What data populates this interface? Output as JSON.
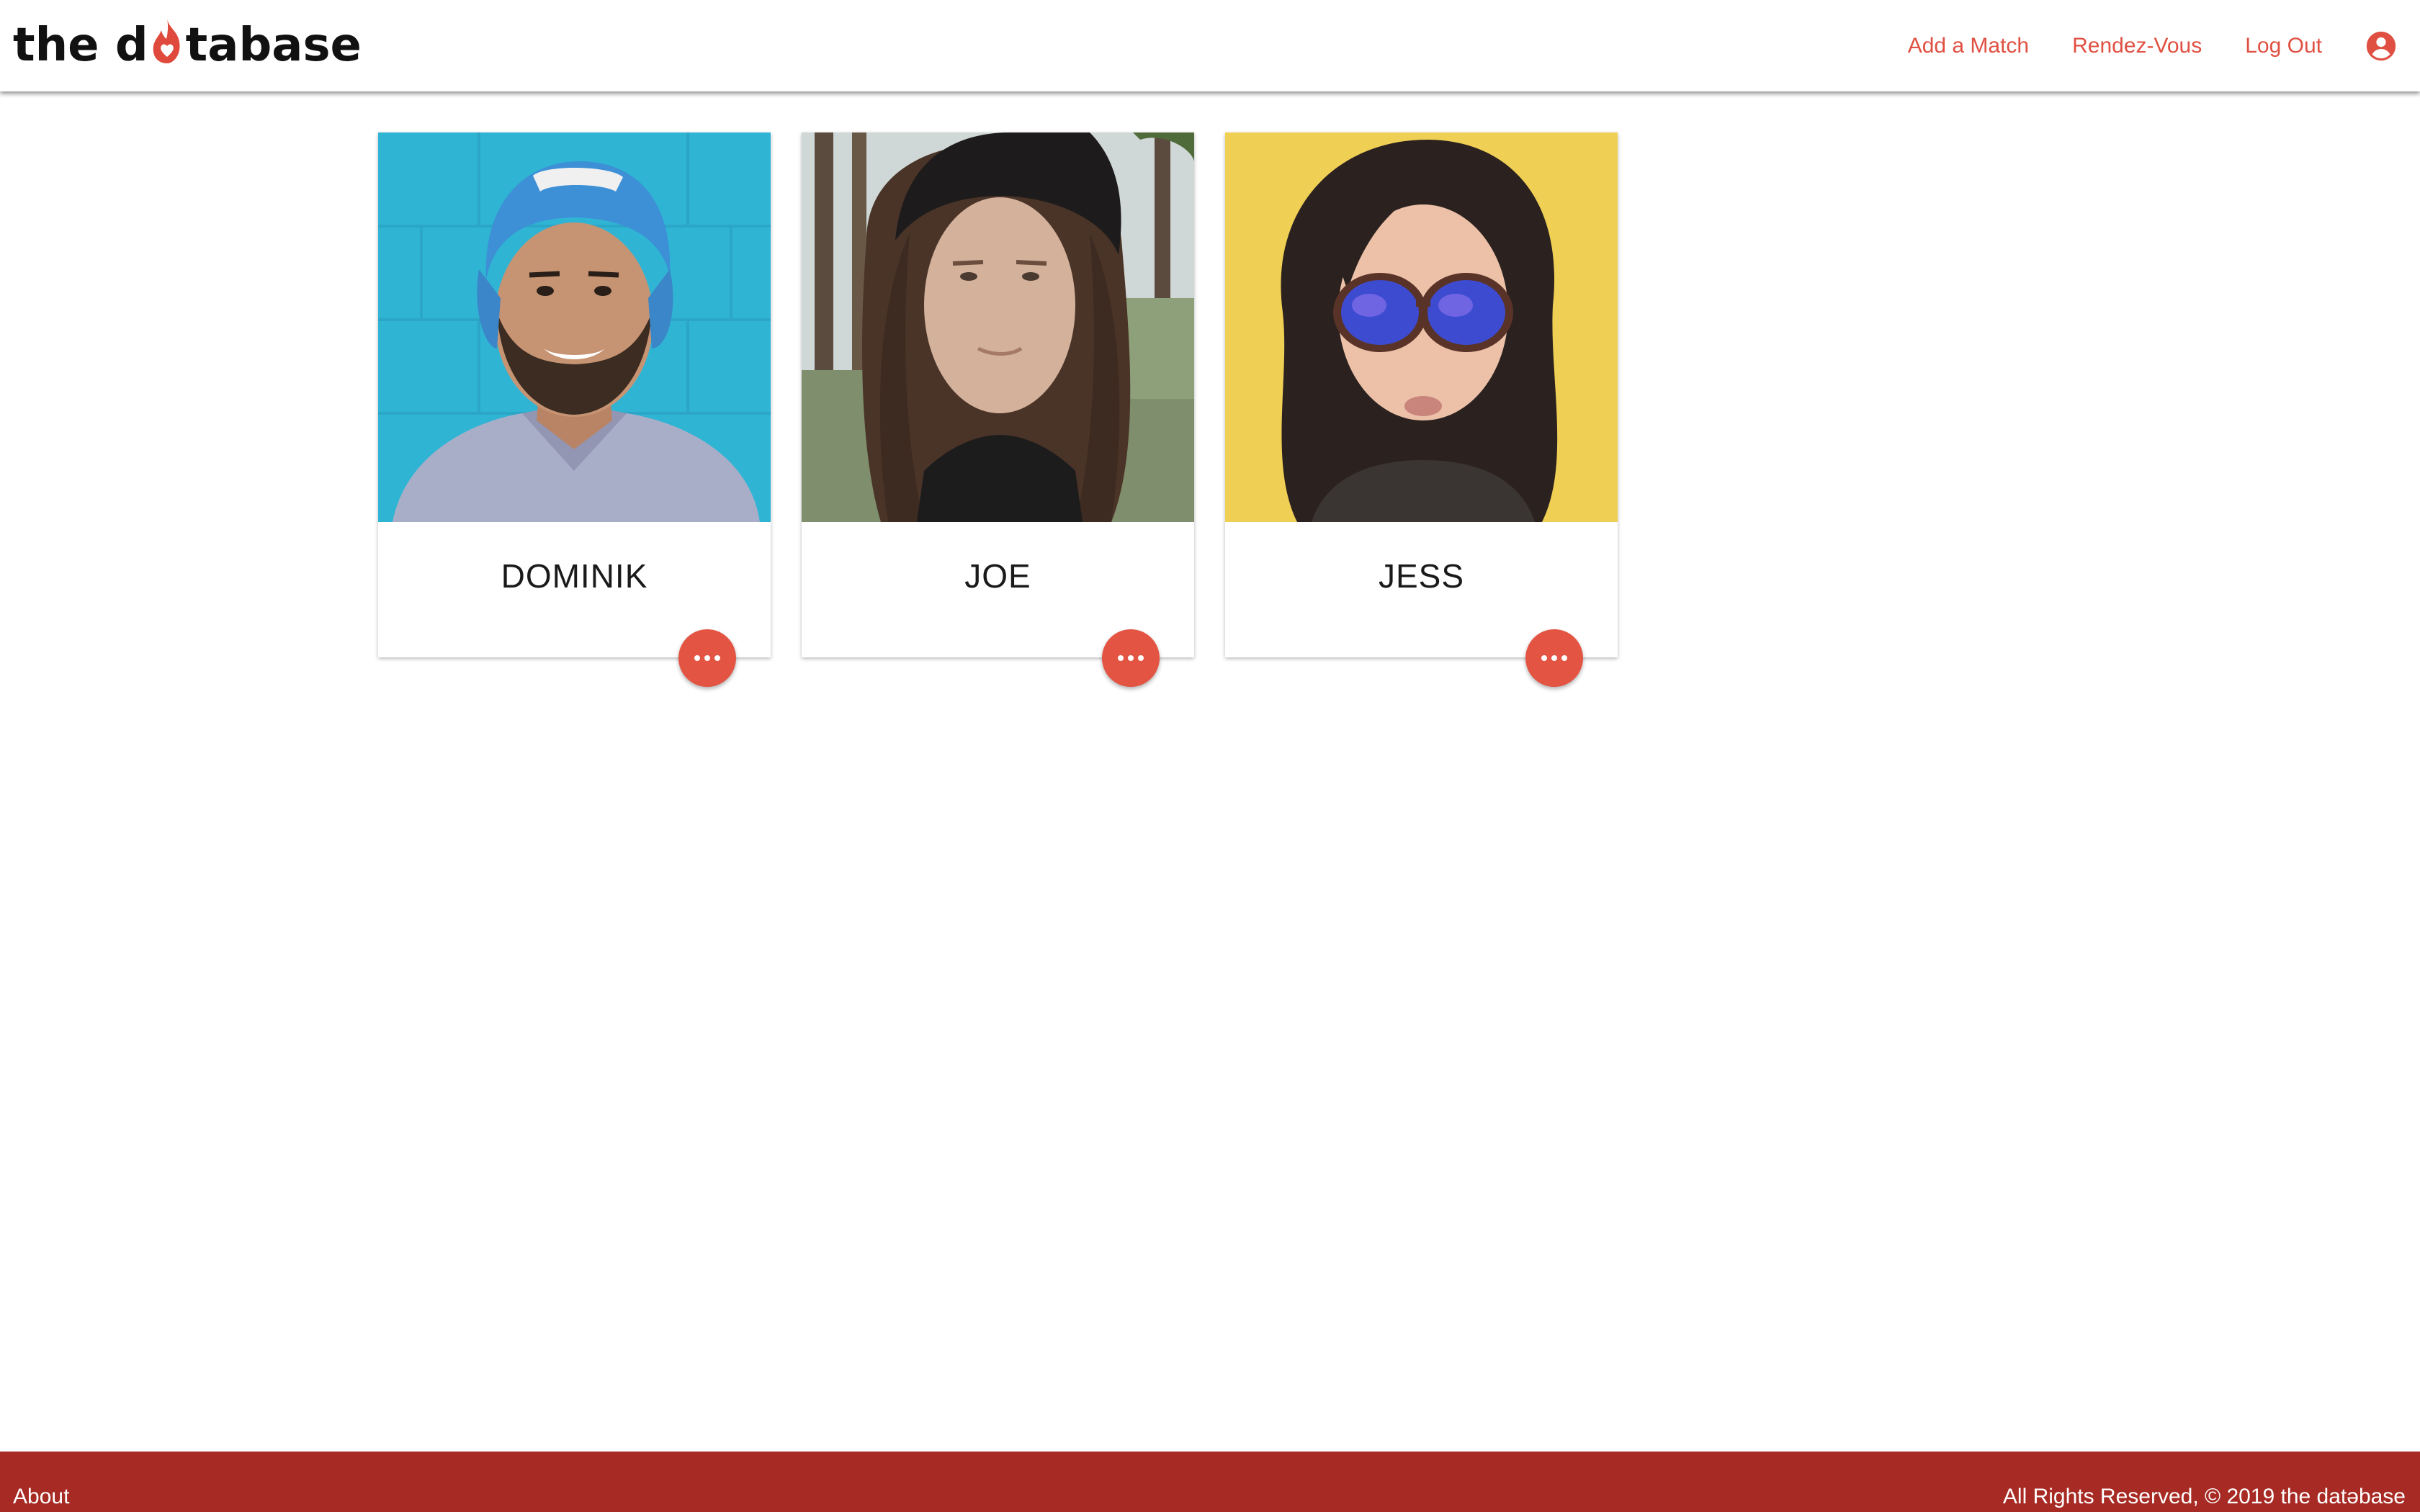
{
  "header": {
    "logo_left": "the d",
    "logo_right": "tabase",
    "logo_icon": "flame-icon",
    "nav": {
      "add_match": "Add a Match",
      "rendez_vous": "Rendez-Vous",
      "log_out": "Log Out",
      "account_icon": "account-circle-icon"
    }
  },
  "cards": [
    {
      "name": "DOMINIK",
      "photo": "profile photo",
      "menu_icon": "more-horizontal-icon"
    },
    {
      "name": "JOE",
      "photo": "profile photo",
      "menu_icon": "more-horizontal-icon"
    },
    {
      "name": "JESS",
      "photo": "profile photo",
      "menu_icon": "more-horizontal-icon"
    }
  ],
  "footer": {
    "about": "About",
    "copyright": "All Rights Reserved, © 2019 the datəbase"
  },
  "colors": {
    "accent": "#e05042",
    "fab": "#e35443",
    "footer_bg": "#a72b24",
    "header_bg": "#ffffff"
  }
}
